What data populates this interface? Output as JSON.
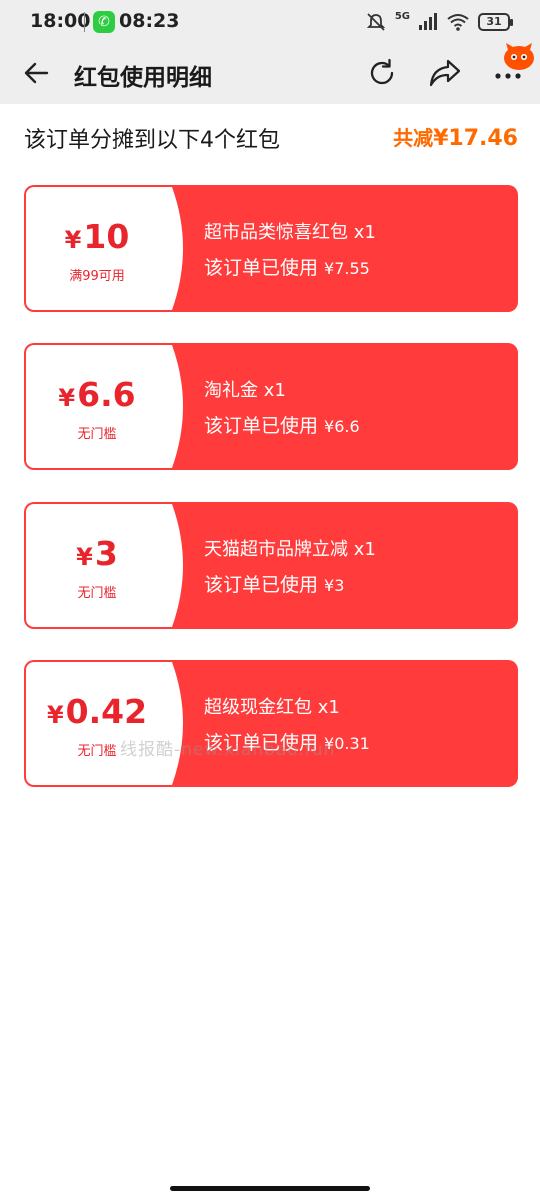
{
  "status_bar": {
    "time": "18:00",
    "call_time": "08:23",
    "network": "5G",
    "battery": "31"
  },
  "nav": {
    "title": "红包使用明细"
  },
  "summary": {
    "text": "该订单分摊到以下4个红包",
    "total_label": "共减",
    "total_amount": "¥17.46"
  },
  "coupons": [
    {
      "yen": "¥",
      "amount": "10",
      "condition": "满99可用",
      "name": "超市品类惊喜红包 x1",
      "used_label": "该订单已使用",
      "used_amount": "¥7.55"
    },
    {
      "yen": "¥",
      "amount": "6.6",
      "condition": "无门槛",
      "name": "淘礼金 x1",
      "used_label": "该订单已使用",
      "used_amount": "¥6.6"
    },
    {
      "yen": "¥",
      "amount": "3",
      "condition": "无门槛",
      "name": "天猫超市品牌立减 x1",
      "used_label": "该订单已使用",
      "used_amount": "¥3"
    },
    {
      "yen": "¥",
      "amount": "0.42",
      "condition": "无门槛",
      "name": "超级现金红包 x1",
      "used_label": "该订单已使用",
      "used_amount": "¥0.31"
    }
  ],
  "watermark": "线报酷-new.xianbao.fun",
  "colors": {
    "accent_red": "#ff3b3b",
    "amount_red": "#e8242c",
    "total_orange": "#ff6a00"
  }
}
